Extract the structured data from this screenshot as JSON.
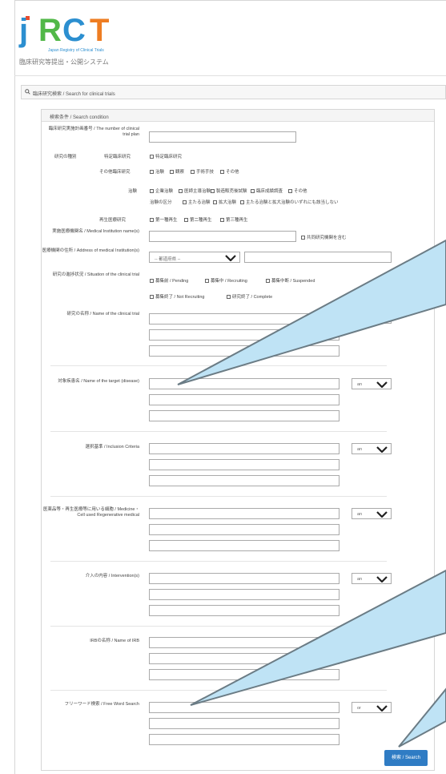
{
  "header": {
    "logo_letters": [
      "j",
      "R",
      "C",
      "T"
    ],
    "logo_sub": "Japan Registry of Clinical Trials",
    "system_name": "臨床研究等提出・公開システム"
  },
  "search_bar": {
    "label": "臨床研究検索 / Search for clinical trials"
  },
  "conditions": {
    "title": "検索条件 / Search condition",
    "plan_number_label": "臨床研究実施計画番号 / The number of clinical trial plan",
    "research_type_label": "研究の種別",
    "specific_label": "特定臨床研究",
    "specific_option": "特定臨床研究",
    "other_research_label": "その他臨床研究",
    "other_research_options": [
      "治験",
      "観察",
      "手術手技",
      "その他"
    ],
    "trial_label": "治験",
    "trial_options": [
      "企業治験",
      "医師主導治験",
      "製造販売後試験",
      "臨床成績調査",
      "その他"
    ],
    "trial_class_label": "治験の区分",
    "trial_class_options": [
      "主たる治験",
      "拡大治験",
      "主たる治験と拡大治験のいずれにも該当しない"
    ],
    "regen_label": "再生医療研究",
    "regen_options": [
      "第一種再生",
      "第二種再生",
      "第三種再生"
    ],
    "institution_label": "実施医療機関名 / Medical Institution name(s)",
    "include_collab": "共同研究機関を含む",
    "address_label": "医療機関の住所 / Address of medical Institution(s)",
    "prefecture_placeholder": "-- 都道府県 --",
    "status_label": "研究の進捗状況 / Situation of the clinical trial",
    "status_options_row1": [
      "募集前 / Pending",
      "募集中 / Recruiting",
      "募集中断 / Suspended"
    ],
    "status_options_row2": [
      "募集終了 / Not Recruiting",
      "研究終了 / Complete"
    ],
    "name_label": "研究の名称 / Name of the clinical trial",
    "disease_label": "対象疾患名 / Name of the target (disease)",
    "inclusion_label": "選択基準 / Inclusion Criteria",
    "medicine_label": "医薬品等・再生医療等に用いる細胞 / Medicine・Cell used Regenerative medical",
    "intervention_label": "介入の内容 / Intervention(s)",
    "irb_label": "IRBの名称 / Name of IRB",
    "freeword_label": "フリーワード検索 / Free Word Search",
    "and_option": "an",
    "or_option": "or"
  },
  "search_button": "検索 / Search",
  "colors": {
    "accent": "#2f7cc4",
    "callout_fill": "#bfe3f5",
    "callout_stroke": "#6b7c85"
  }
}
